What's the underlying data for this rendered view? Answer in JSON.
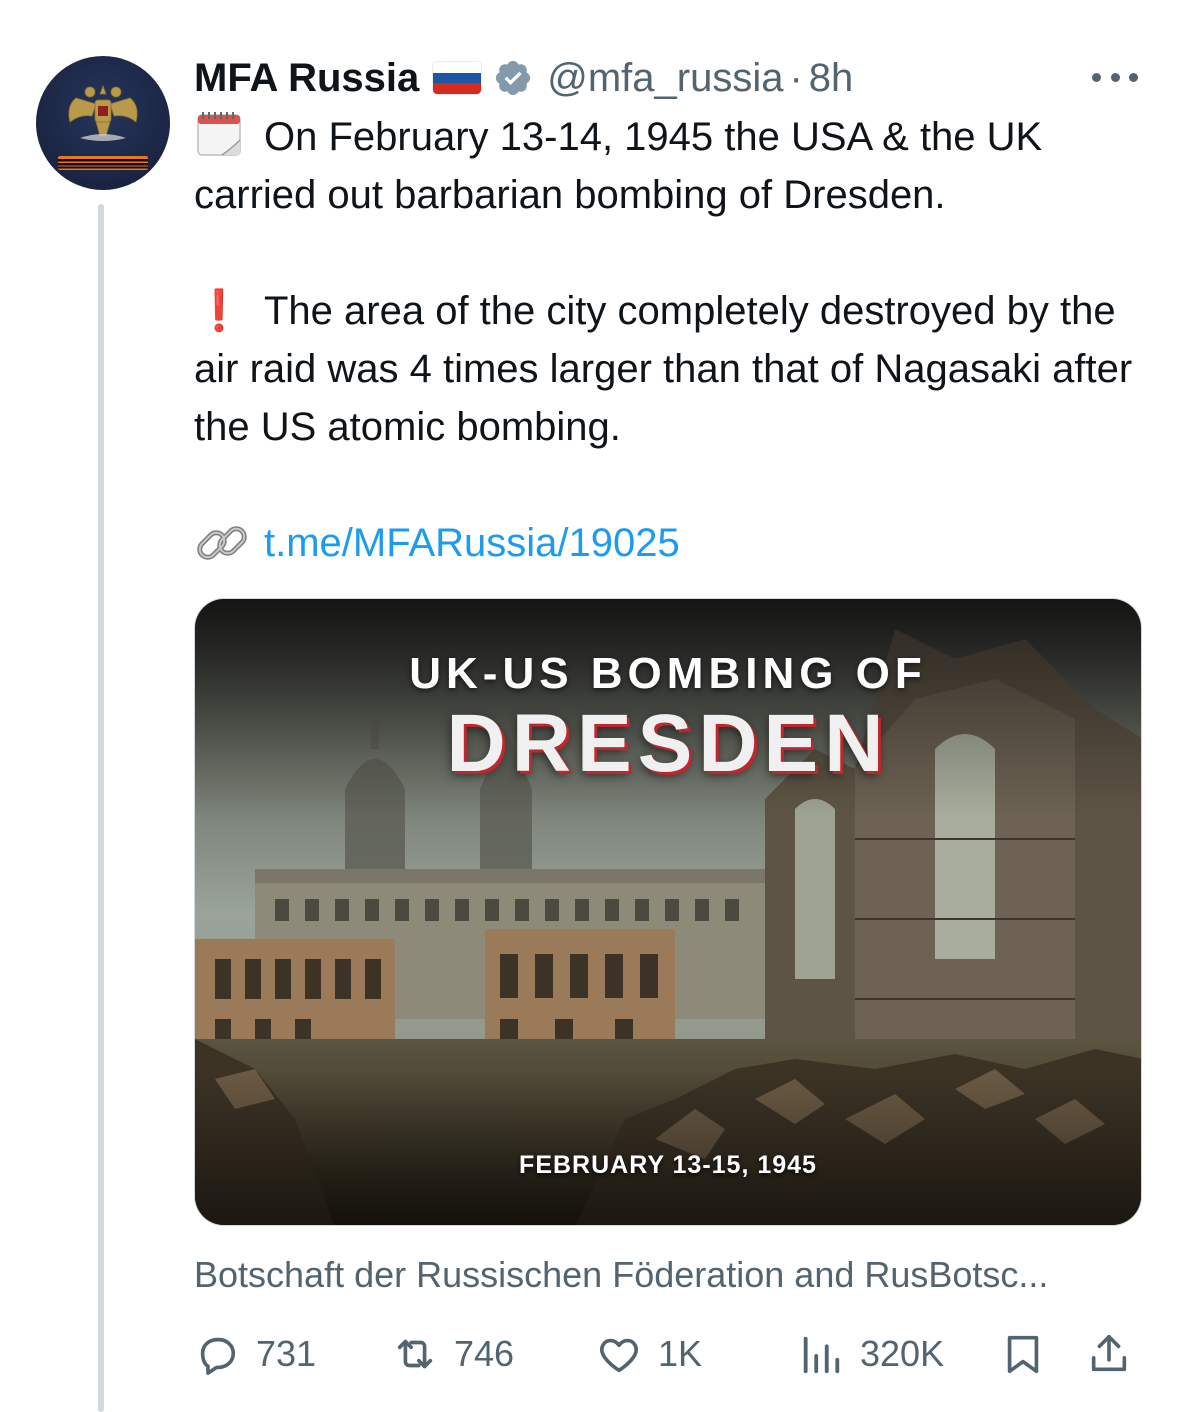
{
  "tweet": {
    "display_name": "MFA Russia",
    "flag_colors": [
      "#ffffff",
      "#1c57a5",
      "#d52b1e"
    ],
    "verified_icon": "verified-badge-icon",
    "handle": "@mfa_russia",
    "separator": "·",
    "time": "8h",
    "paragraph_1": "On February 13-14, 1945 the USA & the UK carried out barbarian bombing of Dresden.",
    "paragraph_2": "The area of the city completely destroyed by the air raid was 4 times larger than that of Nagasaki after the US atomic bombing.",
    "emoji_1": "calendar-emoji",
    "emoji_2_char": "❗",
    "link_icon": "link-emoji",
    "link_text": "t.me/MFARussia/19025"
  },
  "media": {
    "title_line1": "UK-US BOMBING OF",
    "title_line2": "DRESDEN",
    "date": "FEBRUARY 13-15, 1945"
  },
  "caption": "Botschaft der Russischen Föderation and RusBotsc...",
  "actions": {
    "replies": "731",
    "reposts": "746",
    "likes": "1K",
    "views": "320K"
  },
  "colors": {
    "text": "#0f1419",
    "secondary": "#536471",
    "link": "#1d9bf0",
    "thread_line": "#cfd9de"
  }
}
